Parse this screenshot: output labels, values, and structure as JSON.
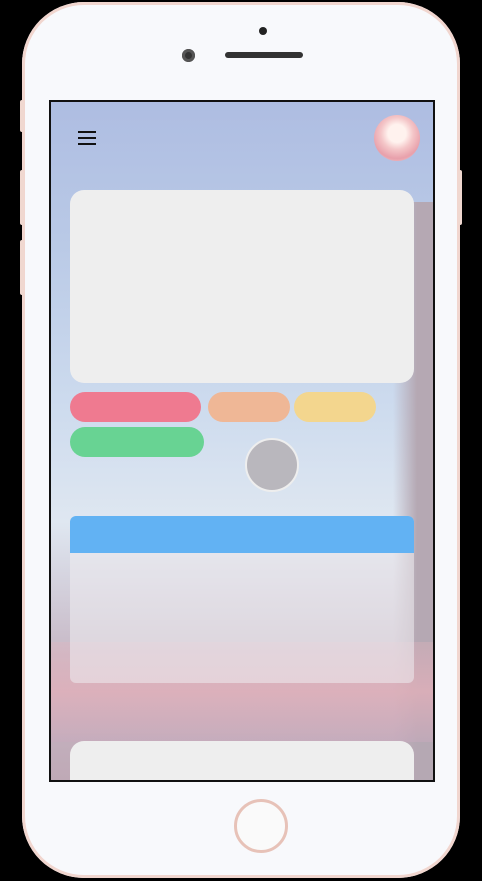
{
  "colors": {
    "pill_red": "#ef7a90",
    "pill_orange": "#efb796",
    "pill_yellow": "#f3d68e",
    "pill_green": "#68d393",
    "card_header_blue": "#62b2f3",
    "card_bg": "#eeeeee"
  },
  "icons": {
    "menu": "hamburger-menu-icon",
    "avatar": "user-avatar"
  }
}
